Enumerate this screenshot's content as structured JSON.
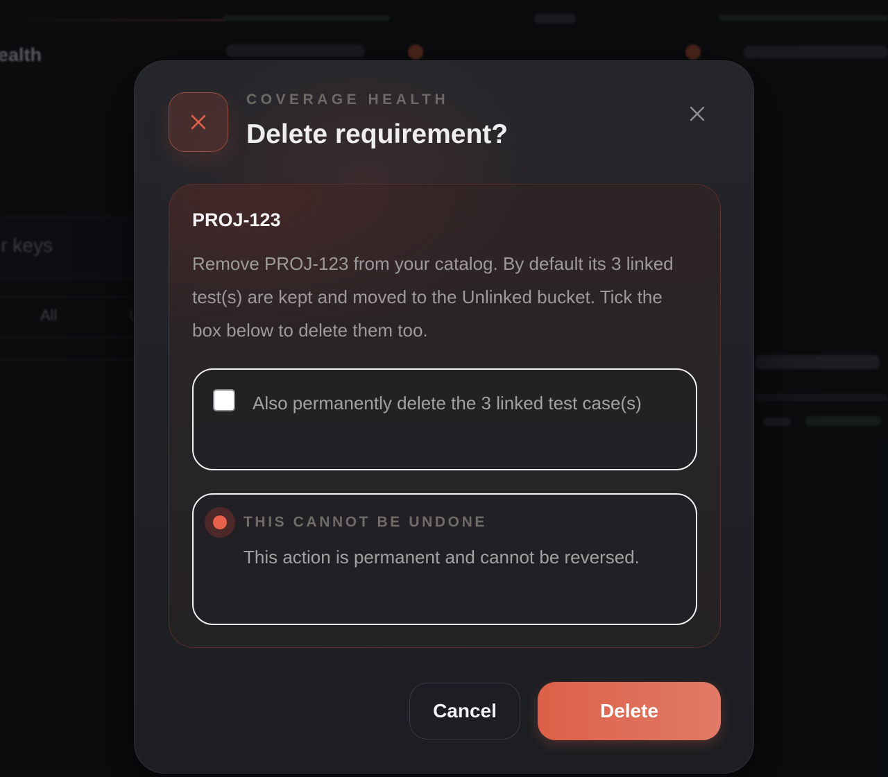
{
  "background": {
    "section_title": "Coverage Health",
    "search_placeholder": "Search by title or keys",
    "filter_tabs": [
      "All",
      "Unlinked"
    ]
  },
  "modal": {
    "eyebrow": "COVERAGE HEALTH",
    "title": "Delete requirement?",
    "icon": "close-icon",
    "close_icon": "close-icon",
    "requirement_key": "PROJ-123",
    "description": "Remove PROJ-123 from your catalog. By default its 3 linked test(s) are kept and moved to the Unlinked bucket. Tick the box below to delete them too.",
    "option": {
      "label": "Also permanently delete the 3 linked test case(s)",
      "checked": false
    },
    "warning": {
      "title": "THIS CANNOT BE UNDONE",
      "text": "This action is permanent and cannot be reversed."
    },
    "buttons": {
      "cancel": "Cancel",
      "delete": "Delete"
    }
  },
  "colors": {
    "accent": "#e8614a",
    "delete_gradient_start": "#dd6048",
    "delete_gradient_end": "#e07a66",
    "modal_bg": "#22242a"
  }
}
